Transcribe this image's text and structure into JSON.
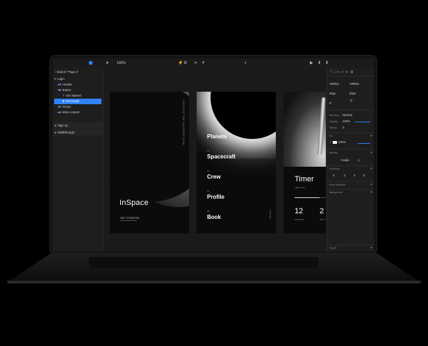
{
  "toolbar": {
    "zoom": "100%",
    "tools": [
      "▶",
      "⚡",
      "⚙",
      "⌗",
      "✈",
      "◐",
      "▶",
      "⬇",
      "⬆"
    ]
  },
  "layers": {
    "search_placeholder": "Search \"Page 1\"",
    "items": [
      {
        "label": "Login",
        "indent": 0
      },
      {
        "label": "Header",
        "indent": 1
      },
      {
        "label": "Button",
        "indent": 1
      },
      {
        "label": "Get Started",
        "indent": 2
      },
      {
        "label": "Rectangle",
        "indent": 2,
        "selected": true
      },
      {
        "label": "Group",
        "indent": 1
      },
      {
        "label": "Main content",
        "indent": 1
      }
    ],
    "sections": [
      "Sign up",
      "Walkthrough"
    ]
  },
  "screens": {
    "login": {
      "title": "InSpace",
      "button": "GET STARTED",
      "vertical": "EXPLORE THE UNIVERSE NOW"
    },
    "menu": {
      "items": [
        {
          "num": "01",
          "label": "Planets"
        },
        {
          "num": "02",
          "label": "Spacecraft"
        },
        {
          "num": "03",
          "label": "Crew"
        },
        {
          "num": "04",
          "label": "Profile"
        },
        {
          "num": "05",
          "label": "Book"
        }
      ],
      "vertical": "LOG OUT"
    },
    "timer": {
      "title": "Timer",
      "sub": "TIME LEFT",
      "values": [
        {
          "num": "12",
          "unit": "MONTHS"
        },
        {
          "num": "2",
          "unit": "DAYS"
        }
      ],
      "progress": 0.6
    }
  },
  "inspector": {
    "width": "1604px",
    "height": "1990px",
    "w2": "60px",
    "h2": "60px",
    "angle": "0°",
    "blending": "Normal",
    "opacity": "100%",
    "radius": "0",
    "fill_label": "Fill",
    "fill_opacity": "100%",
    "borders_label": "Borders",
    "border_pos": "Inside",
    "border_width": "1",
    "shadows_label": "Shadows",
    "shadow_vals": [
      "0",
      "2",
      "4",
      "0"
    ],
    "inner_shadows_label": "Inner Shadows",
    "blur_label": "Background",
    "export_label": "Export"
  }
}
